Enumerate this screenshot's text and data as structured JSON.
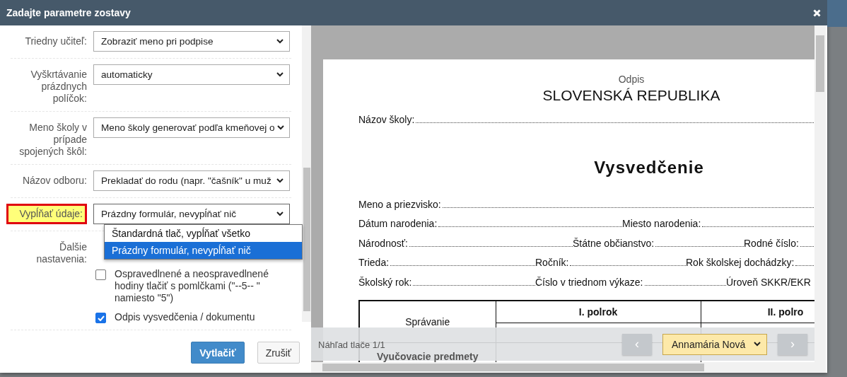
{
  "dialog": {
    "title": "Zadajte parametre zostavy"
  },
  "form": {
    "rows": [
      {
        "kind": "select",
        "label": "Triedny učiteľ:",
        "value": "Zobraziť meno pri podpise",
        "highlighted": false,
        "expanded": false
      },
      {
        "kind": "select",
        "label": "Vyškrtávanie prázdnych políčok:",
        "value": "automaticky",
        "highlighted": false,
        "expanded": false
      },
      {
        "kind": "select",
        "label": "Meno školy v prípade spojených škôl:",
        "value": "Meno školy generovať podľa kmeňovej o",
        "highlighted": false,
        "expanded": false
      },
      {
        "kind": "select",
        "label": "Názov odboru:",
        "value": "Prekladať do rodu (napr. \"čašník\" u muž",
        "highlighted": false,
        "expanded": false
      },
      {
        "kind": "select",
        "label": "Vypĺňať údaje:",
        "value": "Prázdny formulár, nevypĺňať nič",
        "highlighted": true,
        "expanded": true,
        "options": [
          {
            "label": "Štandardná tlač, vypĺňať všetko",
            "selected": false
          },
          {
            "label": "Prázdny formulár, nevypĺňať nič",
            "selected": true
          }
        ]
      },
      {
        "kind": "checks",
        "label": "Ďalšie nastavenia:",
        "highlighted": false,
        "items": [
          {
            "label": "Ospravedlnené a neospravedlnené hodiny tlačiť s pomlčkami (\"--5-- \" namiesto \"5\")",
            "checked": false
          },
          {
            "label": "Odpis vysvedčenia / dokumentu",
            "checked": true
          }
        ]
      }
    ]
  },
  "buttons": [
    {
      "label": "Vytlačiť",
      "kind": "primary"
    },
    {
      "label": "Zrušiť",
      "kind": "secondary"
    }
  ],
  "preview": {
    "document": {
      "note": "Odpis",
      "country": "SLOVENSKÁ REPUBLIKA",
      "school_label": "Názov školy:",
      "title": "Vysvedčenie",
      "field_rows": [
        [
          "Meno a priezvisko:"
        ],
        [
          "Dátum narodenia:",
          "Miesto narodenia:"
        ],
        [
          "Národnosť:",
          "Štátne občianstvo:",
          "Rodné číslo:"
        ],
        [
          "Trieda:",
          "Ročník:",
          "Rok školskej dochádzky:"
        ],
        [
          "Školský rok:",
          "Číslo v triednom výkaze:",
          "Úroveň SKKR/EKR"
        ]
      ],
      "table": {
        "behaviour": "Správanie",
        "term_1": "I. polrok",
        "term_2": "II. polro",
        "subjects": "Vyučovacie predmety"
      }
    },
    "status": "Náhľad tlače 1/1",
    "prev": "‹",
    "student": "Annamária Nová",
    "next": "›"
  }
}
